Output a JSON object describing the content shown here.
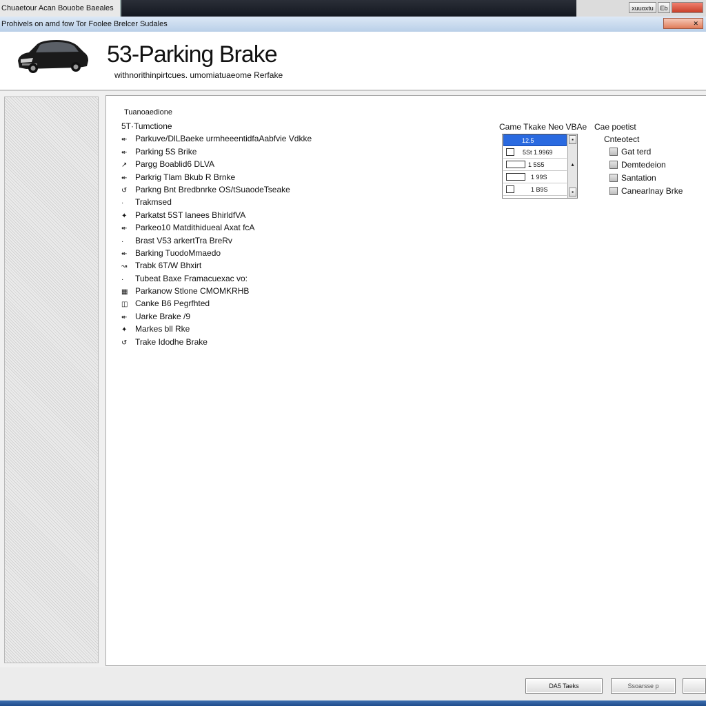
{
  "window": {
    "title": "Chuaetour Acan Bouobe Baeales",
    "controls": {
      "minimize": "xuuoxtu",
      "maximize": "Eb",
      "close": ""
    }
  },
  "menubar": {
    "text": "Prohivels on amd fow Tor Foolee Brelcer Sudales",
    "close_label": "✕"
  },
  "header": {
    "title": "53-Parking Brake",
    "subtitle": "withnorithinpirtcues. umomiatuaeome Rerfake"
  },
  "content": {
    "section_label": "Tuanoaedione",
    "list": [
      {
        "mark": "5T·",
        "label": "Tumctione",
        "header": true
      },
      {
        "mark": "↞",
        "label": "Parkuve/DlLBaeke urmheeentidfaAabfvie Vdkke"
      },
      {
        "mark": "↞",
        "label": "Parking 5S Brike"
      },
      {
        "mark": "↗",
        "label": "Pargg Boablid6 DLVA"
      },
      {
        "mark": "↞",
        "label": "Parkrig Tlam Bkub R Brnke"
      },
      {
        "mark": "↺",
        "label": "Parkng Bnt Bredbnrke OS/tSuaodeTseake"
      },
      {
        "mark": "·",
        "label": "Trakmsed"
      },
      {
        "mark": "✦",
        "label": "Parkatst 5ST lanees BhirldfVA"
      },
      {
        "mark": "↞",
        "label": "Parkeo10 Matdithidueal Axat fcA"
      },
      {
        "mark": "·",
        "label": "Brast V53 arkertTra BreRv"
      },
      {
        "mark": "↞",
        "label": "Barking TuodoMmaedo"
      },
      {
        "mark": "↝",
        "label": "Trabk 6T/W Bhxirt"
      },
      {
        "mark": "·",
        "label": "Tubeat Baxe Framacuexac vo:"
      },
      {
        "mark": "▦",
        "label": "Parkanow Stlone CMOMKRHB"
      },
      {
        "mark": "◫",
        "label": "Canke B6 Pegrfhted"
      },
      {
        "mark": "↞",
        "label": "Uarke Brake /9"
      },
      {
        "mark": "✦",
        "label": "Markes bll Rke"
      },
      {
        "mark": "↺",
        "label": "Trake Idodhe Brake"
      }
    ],
    "table_label": "Came Tkake Neo VBAe",
    "table_rows": [
      {
        "value": "12.5",
        "selected": true
      },
      {
        "value": "5St 1.9969"
      },
      {
        "value": "1 5S5"
      },
      {
        "value": "1 99S"
      },
      {
        "value": "1 B9S"
      }
    ],
    "options_label": "Cae poetist",
    "options_sub": "Cnteotect",
    "options": [
      {
        "label": "Gat terd"
      },
      {
        "label": "Demtedeion"
      },
      {
        "label": "Santation"
      },
      {
        "label": "Canearlnay Brke"
      }
    ]
  },
  "footer": {
    "buttons": [
      "DA5 Taeks",
      "Ssoarsse p",
      ""
    ]
  },
  "colors": {
    "selection": "#2a6ae0",
    "menubar": "#c9dcef",
    "bottom_strip": "#2a5a9c"
  }
}
